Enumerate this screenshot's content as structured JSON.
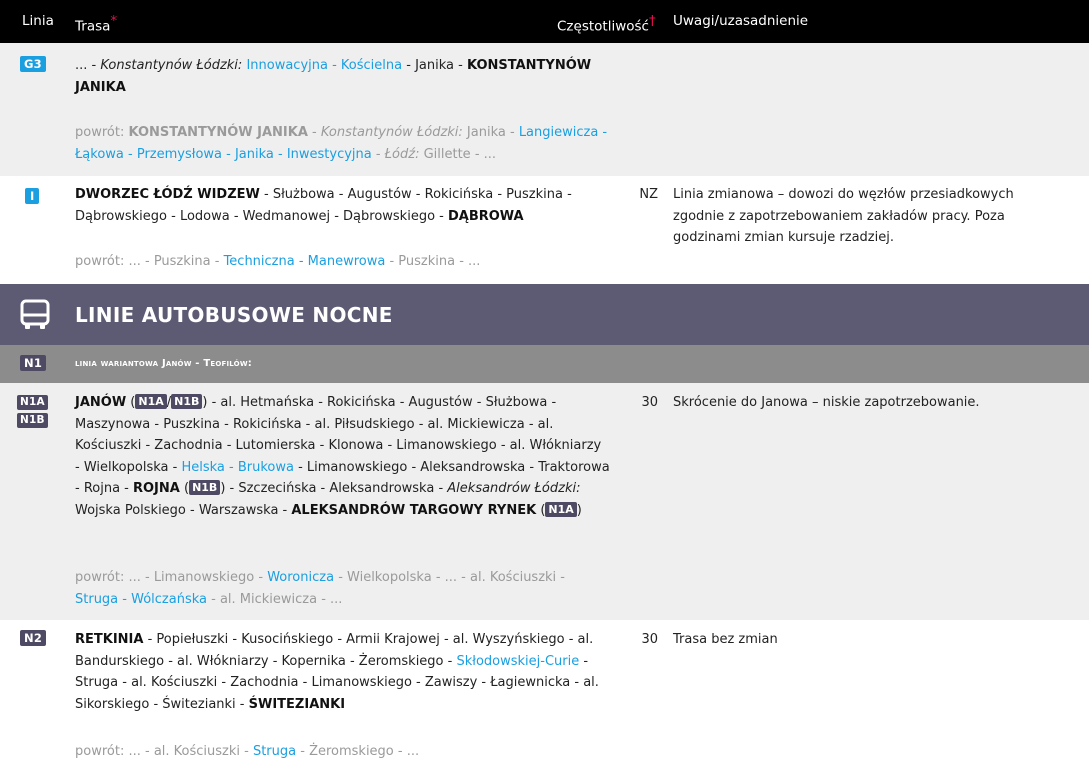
{
  "header": {
    "linia": "Linia",
    "trasa": "Trasa",
    "trasa_mark": "*",
    "czestotliwosc": "Częstotliwość",
    "czestotliwosc_mark": "†",
    "uwagi": "Uwagi/uzasadnienie"
  },
  "rows": {
    "g3": {
      "badge": "G3",
      "t1": "... - ",
      "t2": "Konstantynów Łódzki:",
      "t3": " ",
      "t4": "Innowacyjna - Kościelna",
      "t5": " - Janika - ",
      "t6": "KONSTANTYNÓW JANIKA",
      "r1": "powrót: ",
      "r2": "KONSTANTYNÓW JANIKA",
      "r3": " - ",
      "r4": "Konstantynów Łódzki:",
      "r5": " Janika - ",
      "r6": "Langiewicza - Łąkowa - Przemysłowa - Janika - Inwestycyjna",
      "r7": " - ",
      "r8": "Łódź:",
      "r9": " Gillette - ..."
    },
    "i": {
      "badge": "I",
      "t1": "DWORZEC ŁÓDŹ WIDZEW",
      "t2": " - Służbowa - Augustów - Rokicińska - Puszkina - Dąbrowskiego - Lodowa - Wedmanowej - Dąbrowskiego - ",
      "t3": "DĄBROWA",
      "r1": "powrót: ... - Puszkina - ",
      "r2": "Techniczna - Manewrowa",
      "r3": " - Puszkina - ...",
      "czest": "NZ",
      "uwagi": "Linia zmianowa – dowozi do węzłów przesiadkowych zgodnie z zapotrzebowaniem zakładów pracy. Poza godzinami zmian kursuje rzadziej."
    },
    "n1a": {
      "badge1": "N1A",
      "badge2": "N1B",
      "t1": "JANÓW",
      "t2": " (",
      "t3": "N1A",
      "t4": "/",
      "t5": "N1B",
      "t6": ") - al. Hetmańska - Rokicińska - Augustów - Służbowa - Maszynowa - Puszkina - Rokicińska - al. Piłsudskiego - al. Mickiewicza - al. Kościuszki - Zachodnia - Lutomierska - Klonowa - Limanowskiego - al. Włókniarzy - Wielkopolska - ",
      "t7": "Helska - Brukowa",
      "t8": " - Limanowskiego - Aleksandrowska - Traktorowa - Rojna - ",
      "t9": "ROJNA",
      "t10": " (",
      "t11": "N1B",
      "t12": ") - Szczecińska - Aleksandrowska - ",
      "t13": "Aleksandrów Łódzki:",
      "t14": " Wojska Polskiego - Warszawska - ",
      "t15": "ALEKSANDRÓW TARGOWY RYNEK",
      "t16": " (",
      "t17": "N1A",
      "t18": ")",
      "r1": "powrót: ... - Limanowskiego - ",
      "r2": "Woronicza",
      "r3": " - Wielkopolska - ... - al. Kościuszki - ",
      "r4": "Struga - Wólczańska",
      "r5": " - al. Mickiewicza - ...",
      "czest": "30",
      "uwagi": "Skrócenie do Janowa – niskie zapotrzebowanie."
    },
    "n2": {
      "badge": "N2",
      "t1": "RETKINIA",
      "t2": " - Popiełuszki - Kusocińskiego - Armii Krajowej - al. Wyszyńskiego - al. Bandurskiego - al. Włókniarzy - Kopernika - Żeromskiego - ",
      "t3": "Skłodowskiej-Curie",
      "t4": " - Struga - al. Kościuszki - Zachodnia - Limanowskiego - Zawiszy - Łagiewnicka - al. Sikorskiego - Świtezianki - ",
      "t5": "ŚWITEZIANKI",
      "r1": "powrót: ... - al. Kościuszki - ",
      "r2": "Struga",
      "r3": " - Żeromskiego - ...",
      "czest": "30",
      "uwagi": "Trasa bez zmian"
    }
  },
  "section": {
    "icon": "bus-icon",
    "title": "LINIE AUTOBUSOWE NOCNE"
  },
  "subsection": {
    "badge": "N1",
    "title": "linia wariantowa Janów - Teofilów:"
  },
  "colors": {
    "header_bg": "#000000",
    "row_gray": "#efefef",
    "link_blue": "#1a9fe0",
    "badge_dark": "#4e4a63",
    "section_bg": "#5d5a73",
    "subsection_bg": "#8c8c8c",
    "return_gray": "#9a9a9a",
    "mark_red": "#e0114f"
  }
}
